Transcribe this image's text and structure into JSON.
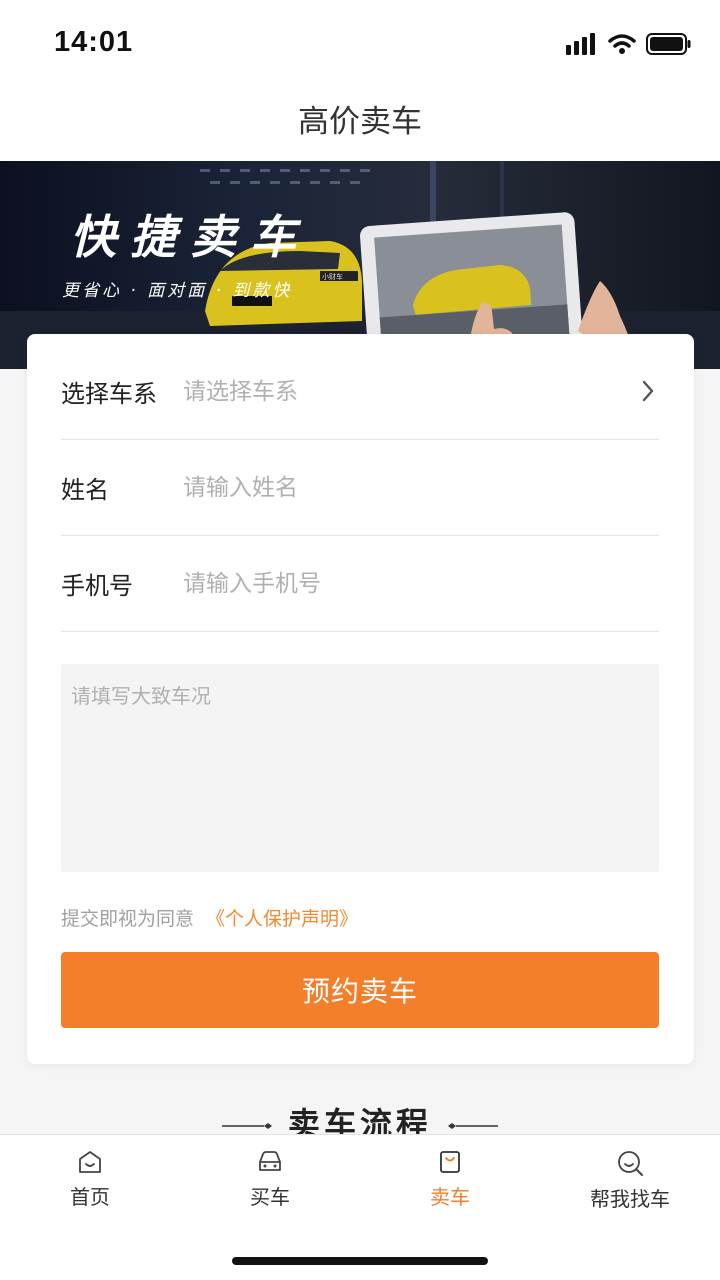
{
  "status_bar": {
    "time": "14:01"
  },
  "nav": {
    "title": "高价卖车"
  },
  "banner": {
    "slogan": "快捷卖车",
    "subtitle": "更省心 · 面对面 · 到款快",
    "sign_text": "小财车"
  },
  "form": {
    "car_series": {
      "label": "选择车系",
      "placeholder": "请选择车系"
    },
    "name": {
      "label": "姓名",
      "placeholder": "请输入姓名"
    },
    "phone": {
      "label": "手机号",
      "placeholder": "请输入手机号"
    },
    "remarks": {
      "placeholder": "请填写大致车况"
    },
    "agreement": {
      "prefix": "提交即视为同意",
      "link": "《个人保护声明》"
    },
    "submit_label": "预约卖车"
  },
  "process": {
    "title": "卖车流程"
  },
  "tabs": [
    {
      "label": "首页",
      "icon": "home-icon",
      "active": false
    },
    {
      "label": "买车",
      "icon": "car-icon",
      "active": false
    },
    {
      "label": "卖车",
      "icon": "shopping-bag-icon",
      "active": true
    },
    {
      "label": "帮我找车",
      "icon": "search-face-icon",
      "active": false
    }
  ],
  "colors": {
    "accent": "#f37f2b",
    "link": "#f08a2e",
    "placeholder": "#b0b0b0",
    "banner_yellow_car": "#d9c21e"
  }
}
